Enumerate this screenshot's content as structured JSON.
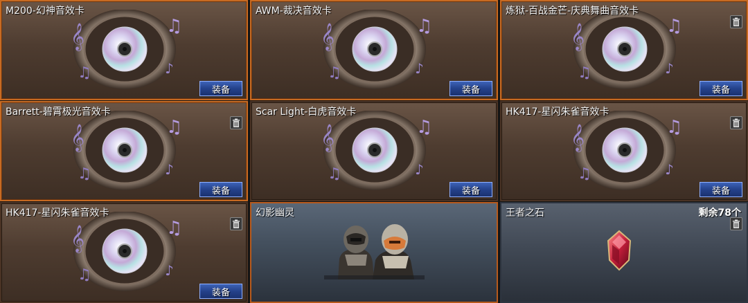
{
  "cards": [
    {
      "title": "M200-幻神音效卡",
      "equip_label": "装备",
      "has_trash": false,
      "selected": true
    },
    {
      "title": "AWM-裁决音效卡",
      "equip_label": "装备",
      "has_trash": false,
      "selected": true
    },
    {
      "title": "炼狱-百战金芒-庆典舞曲音效卡",
      "equip_label": "装备",
      "has_trash": true,
      "selected": true
    },
    {
      "title": "Barrett-碧霄极光音效卡",
      "equip_label": "装备",
      "has_trash": true,
      "selected": true
    },
    {
      "title": "Scar Light-白虎音效卡",
      "equip_label": "装备",
      "has_trash": false,
      "selected": false
    },
    {
      "title": "HK417-星闪朱雀音效卡",
      "equip_label": "装备",
      "has_trash": true,
      "selected": false
    },
    {
      "title": "HK417-星闪朱雀音效卡",
      "equip_label": "装备",
      "has_trash": true,
      "selected": false
    }
  ],
  "character_card": {
    "title": "幻影幽灵"
  },
  "item_card": {
    "title": "王者之石",
    "count_text": "剩余78个"
  },
  "colors": {
    "equip_button": "#24418a",
    "selected_border": "#c76a22",
    "card_brown": "#4e3c30"
  },
  "icons": {
    "trash": "trash-icon",
    "speaker": "speaker-cd-icon",
    "note": "music-note-icon",
    "gem": "red-gem-icon"
  }
}
